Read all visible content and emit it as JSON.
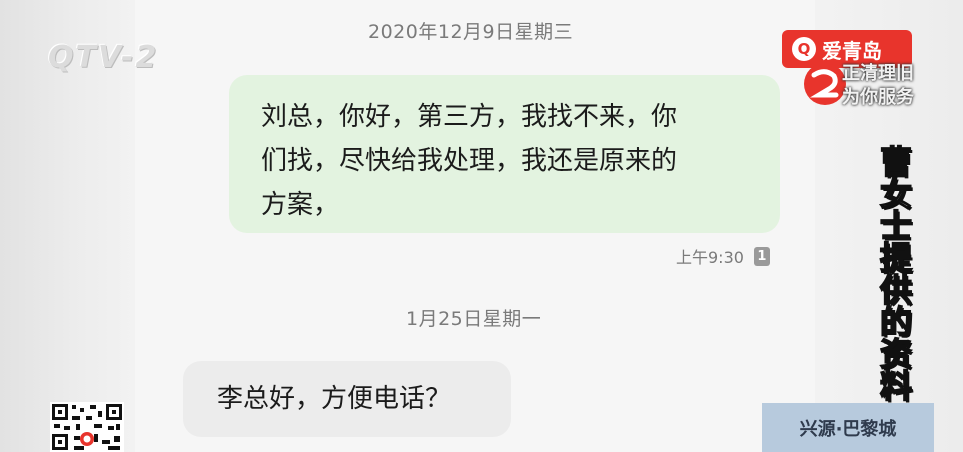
{
  "conversation": {
    "date_1": "2020年12月9日星期三",
    "message_1": {
      "text": "刘总，你好，第三方，我找不来，你们找，尽快给我处理，我还是原来的方案，",
      "lines": [
        "刘总，你好，第三方，我找不来，你",
        "们找，尽快给我处理，我还是原来的",
        "方案，"
      ],
      "time": "上午9:30",
      "read_count": "1"
    },
    "date_2": "1月25日星期一",
    "message_2": {
      "text": "李总好，方便电话？"
    }
  },
  "overlay": {
    "station_logo": "QTV-2",
    "app_badge_label": "爱青岛",
    "program_line_1": "正清理旧",
    "program_line_2": "为你服务",
    "caption": "曹女士提供的资料",
    "location": "兴源·巴黎城"
  },
  "colors": {
    "outgoing_bubble": "#e3f3e0",
    "incoming_bubble": "#ececec",
    "app_badge": "#e8342c",
    "location_banner": "#b7cadd"
  },
  "icons": [
    "read-receipt-icon",
    "app-logo-icon",
    "channel-logo-icon",
    "qr-code-icon"
  ]
}
